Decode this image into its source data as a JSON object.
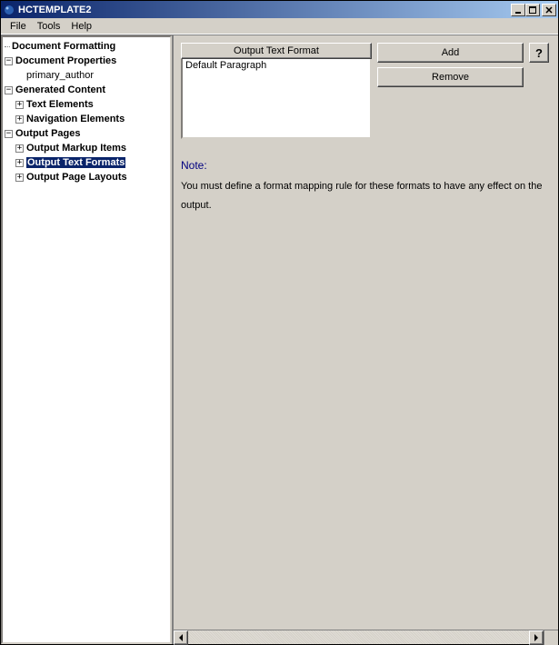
{
  "titlebar": {
    "title": "HCTEMPLATE2"
  },
  "menubar": {
    "file": "File",
    "tools": "Tools",
    "help": "Help"
  },
  "winbtns": {
    "min": "0",
    "max": "1",
    "close": "✕"
  },
  "tree": {
    "doc_formatting": "Document Formatting",
    "doc_properties": "Document Properties",
    "primary_author": "primary_author",
    "generated_content": "Generated Content",
    "text_elements": "Text Elements",
    "navigation_elements": "Navigation Elements",
    "output_pages": "Output Pages",
    "output_markup_items": "Output Markup Items",
    "output_text_formats": "Output Text Formats",
    "output_page_layouts": "Output Page Layouts"
  },
  "list": {
    "header": "Output Text Format",
    "rows": [
      "Default Paragraph"
    ]
  },
  "buttons": {
    "add": "Add",
    "remove": "Remove",
    "help": "?"
  },
  "note": {
    "label": "Note:",
    "text": "You must define a format mapping rule for these formats to have any effect on the output."
  }
}
